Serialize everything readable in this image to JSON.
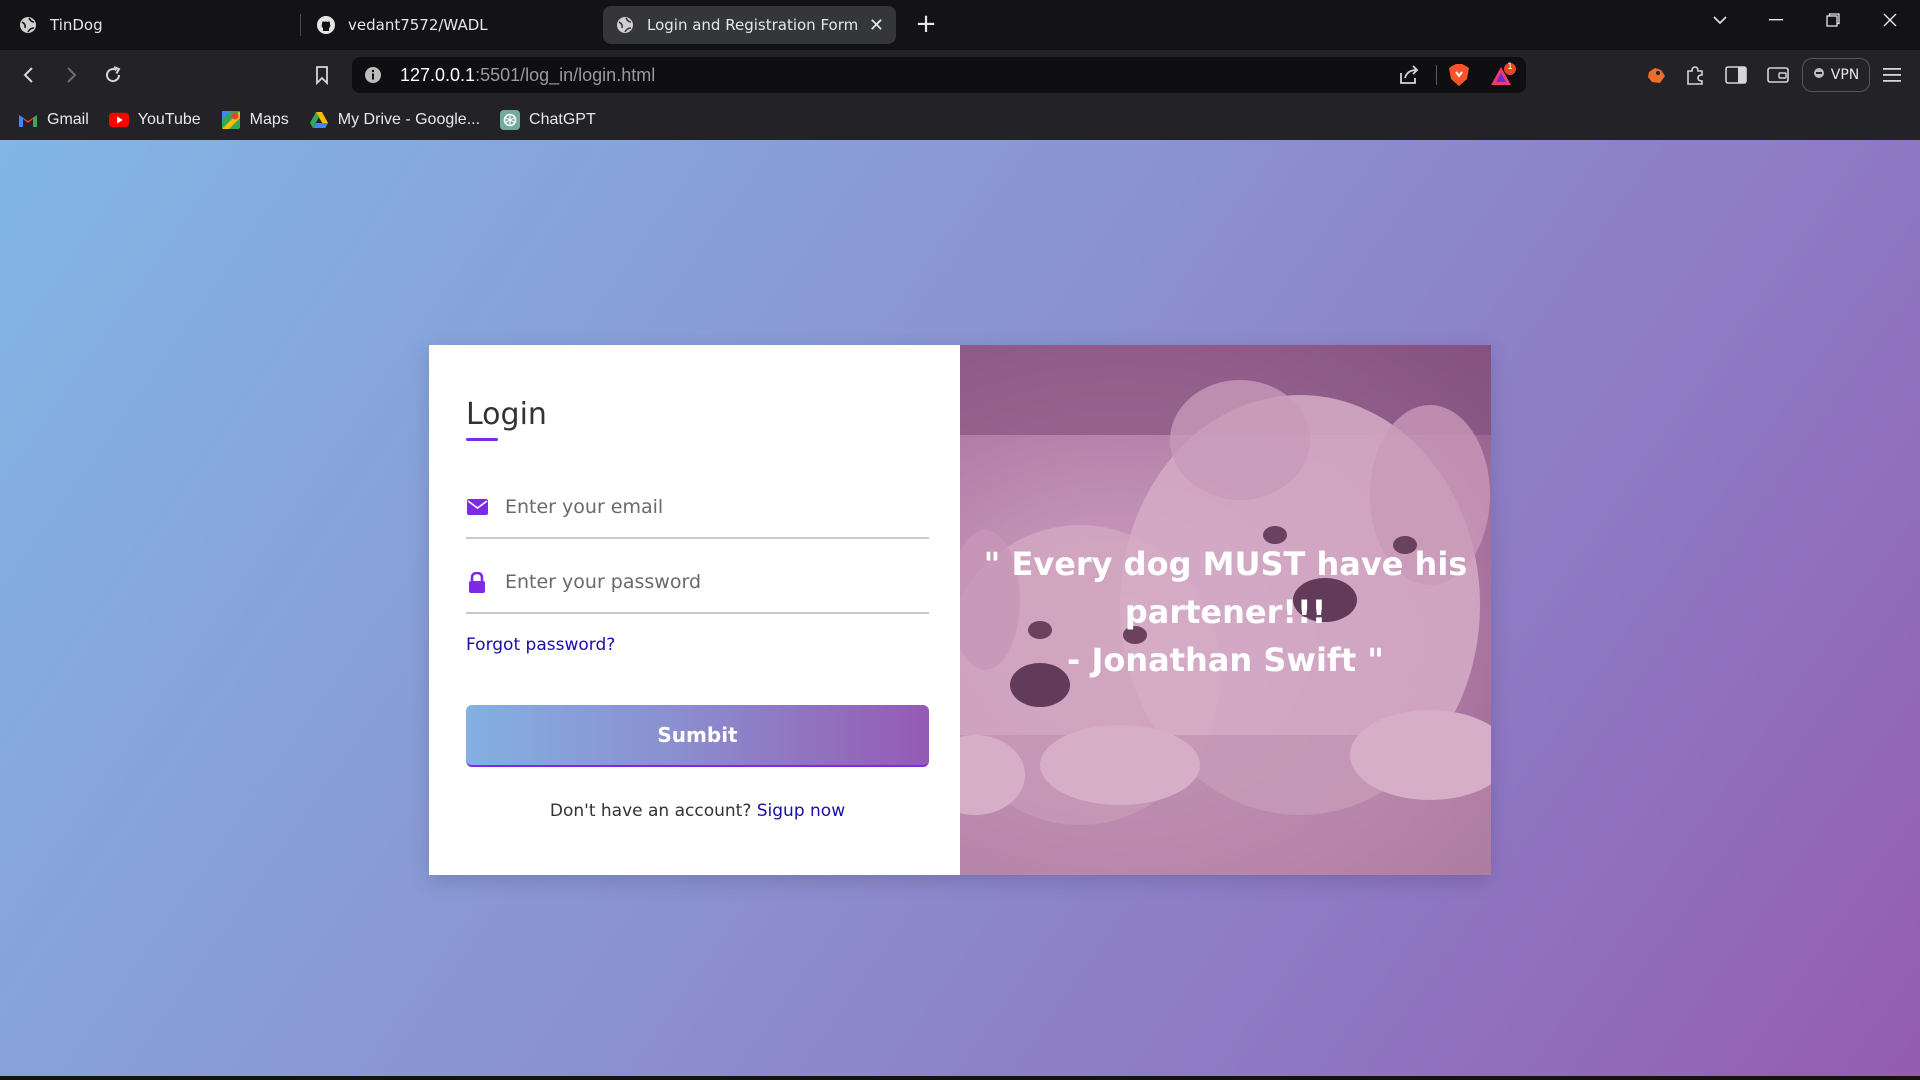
{
  "browser": {
    "tabs": [
      {
        "title": "TinDog",
        "icon": "globe-icon"
      },
      {
        "title": "vedant7572/WADL",
        "icon": "github-icon"
      },
      {
        "title": "Login and Registration Form in H",
        "icon": "globe-icon",
        "active": true
      }
    ],
    "url_host": "127.0.0.1",
    "url_rest": ":5501/log_in/login.html",
    "vpn_label": "VPN",
    "notification_count": "1",
    "bookmarks": [
      {
        "label": "Gmail",
        "icon": "gmail-icon"
      },
      {
        "label": "YouTube",
        "icon": "youtube-icon"
      },
      {
        "label": "Maps",
        "icon": "maps-icon"
      },
      {
        "label": "My Drive - Google...",
        "icon": "drive-icon"
      },
      {
        "label": "ChatGPT",
        "icon": "chatgpt-icon"
      }
    ]
  },
  "login": {
    "title": "Login",
    "email_placeholder": "Enter your email",
    "password_placeholder": "Enter your password",
    "forgot_label": "Forgot password?",
    "submit_label": "Sumbit",
    "signup_prompt": "Don't have an account?",
    "signup_link": "Sigup now"
  },
  "quote": {
    "line1": "\" Every dog MUST have his",
    "line2": "partener!!!",
    "line3": "- Jonathan Swift \""
  },
  "colors": {
    "accent": "#7d2ae8",
    "link": "#1a0dab",
    "gradient_start": "#82b6e6",
    "gradient_end": "#955cb1"
  }
}
